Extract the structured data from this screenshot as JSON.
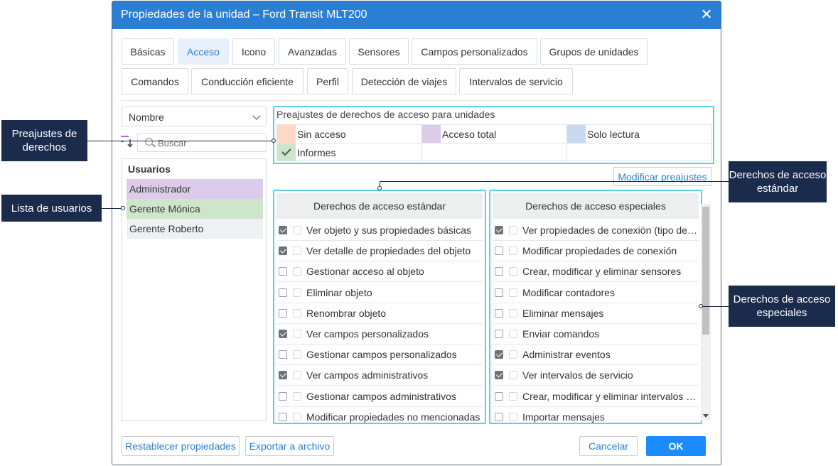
{
  "dialog": {
    "title": "Propiedades de la unidad – Ford Transit MLT200"
  },
  "tabs": [
    {
      "label": "Básicas"
    },
    {
      "label": "Acceso"
    },
    {
      "label": "Icono"
    },
    {
      "label": "Avanzadas"
    },
    {
      "label": "Sensores"
    },
    {
      "label": "Campos personalizados"
    },
    {
      "label": "Grupos de unidades"
    },
    {
      "label": "Comandos"
    },
    {
      "label": "Conducción eficiente"
    },
    {
      "label": "Perfil"
    },
    {
      "label": "Detección de viajes"
    },
    {
      "label": "Intervalos de servicio"
    }
  ],
  "active_tab": "Acceso",
  "left": {
    "sort_select": "Nombre",
    "search_placeholder": "Buscar",
    "users_header": "Usuarios",
    "users": [
      {
        "name": "Administrador",
        "color": "#dccbea"
      },
      {
        "name": "Gerente Mónica",
        "color": "#cde6c9"
      },
      {
        "name": "Gerente Roberto",
        "color": "#eef0f2"
      }
    ]
  },
  "presets": {
    "header": "Preajustes de derechos de acceso para unidades",
    "items": [
      {
        "label": "Sin acceso",
        "color": "#fcd9c2"
      },
      {
        "label": "Acceso total",
        "color": "#dccbea"
      },
      {
        "label": "Solo lectura",
        "color": "#c8d9f2"
      },
      {
        "label": "Informes",
        "color": "#cde6c9"
      }
    ],
    "modify_button": "Modificar preajustes"
  },
  "standard_rights": {
    "header": "Derechos de acceso estándar",
    "items": [
      {
        "label": "Ver objeto y sus propiedades básicas",
        "checked": true
      },
      {
        "label": "Ver detalle de propiedades del objeto",
        "checked": true
      },
      {
        "label": "Gestionar acceso al objeto",
        "checked": false
      },
      {
        "label": "Eliminar objeto",
        "checked": false
      },
      {
        "label": "Renombrar objeto",
        "checked": false
      },
      {
        "label": "Ver campos personalizados",
        "checked": true
      },
      {
        "label": "Gestionar campos personalizados",
        "checked": false
      },
      {
        "label": "Ver campos administrativos",
        "checked": true
      },
      {
        "label": "Gestionar campos administrativos",
        "checked": false
      },
      {
        "label": "Modificar propiedades no mencionadas",
        "checked": false
      }
    ]
  },
  "special_rights": {
    "header": "Derechos de acceso especiales",
    "items": [
      {
        "label": "Ver propiedades de conexión (tipo de dispositivo)",
        "checked": true
      },
      {
        "label": "Modificar propiedades de conexión",
        "checked": false
      },
      {
        "label": "Crear, modificar y eliminar sensores",
        "checked": false
      },
      {
        "label": "Modificar contadores",
        "checked": false
      },
      {
        "label": "Eliminar mensajes",
        "checked": false
      },
      {
        "label": "Enviar comandos",
        "checked": false
      },
      {
        "label": "Administrar eventos",
        "checked": true
      },
      {
        "label": "Ver intervalos de servicio",
        "checked": true
      },
      {
        "label": "Crear, modificar y eliminar intervalos de servicio",
        "checked": false
      },
      {
        "label": "Importar mensajes",
        "checked": false
      }
    ]
  },
  "footer": {
    "reset": "Restablecer propiedades",
    "export": "Exportar a archivo",
    "cancel": "Cancelar",
    "ok": "OK"
  },
  "callouts": {
    "presets": "Preajustes de derechos",
    "users": "Lista de usuarios",
    "standard": "Derechos de acceso estándar",
    "special": "Derechos de acceso especiales"
  }
}
